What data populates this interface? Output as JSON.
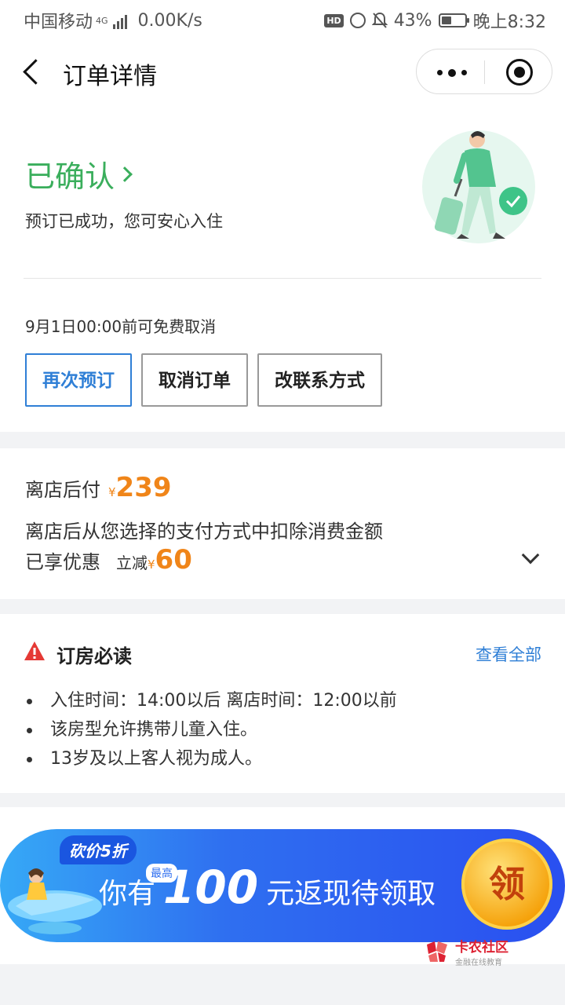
{
  "status_bar": {
    "carrier": "中国移动",
    "network": "4G",
    "speed": "0.00K/s",
    "hd": "HD",
    "battery": "43%",
    "battery_level": 0.43,
    "time": "晚上8:32"
  },
  "nav": {
    "title": "订单详情"
  },
  "order_status": {
    "title": "已确认",
    "subtitle": "预订已成功，您可安心入住",
    "cancel_note": "9月1日00:00前可免费取消",
    "accent_color": "#3aae5c"
  },
  "actions": {
    "rebook": "再次预订",
    "cancel": "取消订单",
    "change_contact": "改联系方式"
  },
  "payment": {
    "label": "离店后付",
    "currency": "¥",
    "amount": "239",
    "description": "离店后从您选择的支付方式中扣除消费金额",
    "discount_label": "已享优惠",
    "discount_prefix": "立减",
    "discount_amount": "60",
    "price_color": "#f08519"
  },
  "notice": {
    "title": "订房必读",
    "view_all": "查看全部",
    "items": [
      "入住时间：14:00以后 离店时间：12:00以前",
      "该房型允许携带儿童入住。",
      "13岁及以上客人视为成人。"
    ]
  },
  "banner": {
    "tag": "砍价5折",
    "prefix": "你有",
    "badge": "最高",
    "amount": "100",
    "suffix": "元返现待领取",
    "button": "领"
  },
  "watermark": {
    "main": "卡农社区",
    "sub": "金融在线教育"
  }
}
